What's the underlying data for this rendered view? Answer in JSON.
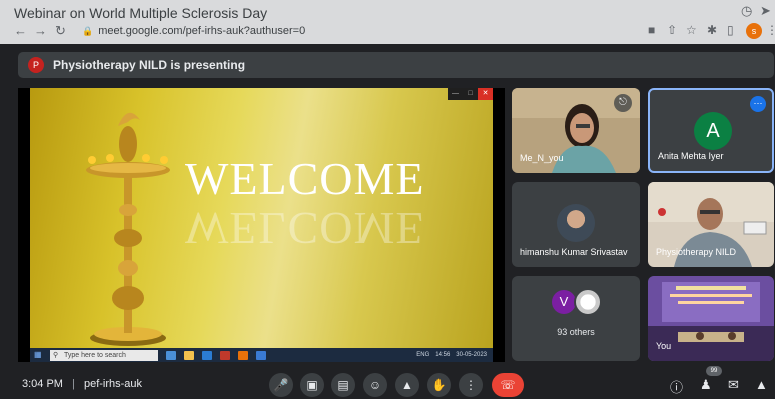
{
  "browser": {
    "window_title": "Webinar on World Multiple Sclerosis Day",
    "url": "meet.google.com/pef-irhs-auk?authuser=0",
    "profile_initial": "s"
  },
  "banner": {
    "avatar_letter": "P",
    "text": "Physiotherapy NILD is presenting"
  },
  "slide": {
    "heading": "WELCOME",
    "reflection": "WELCOME",
    "taskbar_search_placeholder": "Type here to search",
    "taskbar_time": "14:56",
    "taskbar_date": "30-05-2023",
    "taskbar_lang": "ENG"
  },
  "participants": [
    {
      "name": "Me_N_you",
      "muted": true
    },
    {
      "name": "Anita Mehta Iyer",
      "avatar_letter": "A"
    },
    {
      "name": "himanshu Kumar Srivastav"
    },
    {
      "name": "Physiotherapy NILD"
    },
    {
      "others_avatar_letter": "V",
      "others_label": "93 others"
    },
    {
      "name": "You"
    }
  ],
  "bottom": {
    "time": "3:04 PM",
    "meeting_code": "pef-irhs-auk",
    "participant_count": "99"
  },
  "colors": {
    "meet_bg": "#202124",
    "tile_bg": "#3c4043",
    "leave_red": "#ea4335",
    "active_tile_border": "#8ab4f8",
    "avatar_green": "#0b8043",
    "avatar_purple": "#7b1fa2"
  }
}
